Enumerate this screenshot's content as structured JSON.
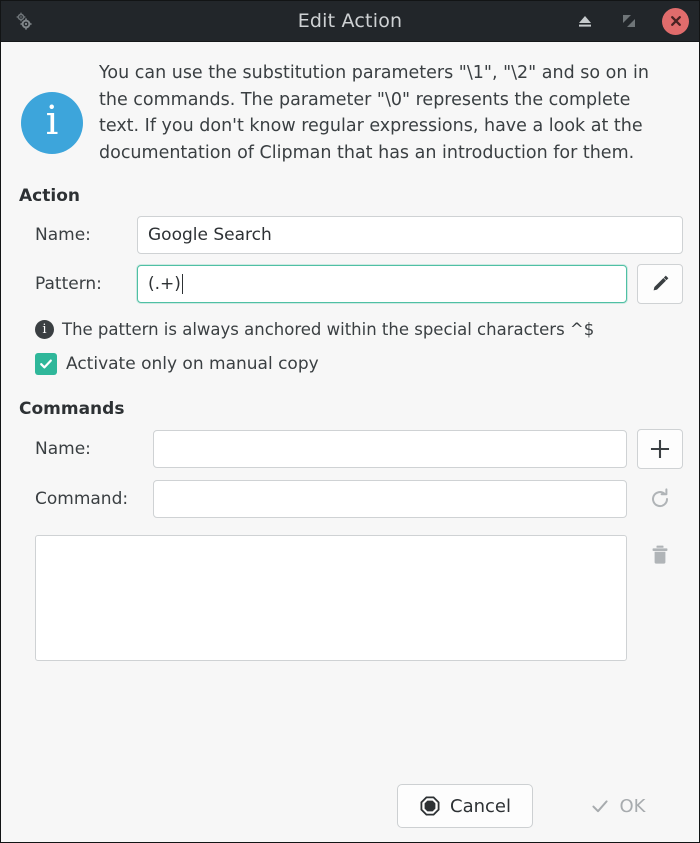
{
  "titlebar": {
    "app_icon": "cogs-icon",
    "title": "Edit Action",
    "buttons": [
      {
        "name": "shade-window-button",
        "icon": "eject-icon"
      },
      {
        "name": "maximize-window-button",
        "icon": "maximize-icon"
      },
      {
        "name": "close-window-button",
        "icon": "close-icon"
      }
    ],
    "close_color": "#e06c6c"
  },
  "info": {
    "icon": "info-circle-icon",
    "icon_color": "#3da5db",
    "glyph": "i",
    "text": "You can use the substitution parameters \"\\1\", \"\\2\" and so on in the commands. The parameter \"\\0\" represents the complete text. If you don't know regular expressions, have a look at the documentation of Clipman that has an introduction for them."
  },
  "action": {
    "section_label": "Action",
    "name_label": "Name:",
    "name_value": "Google Search",
    "name_placeholder": "",
    "pattern_label": "Pattern:",
    "pattern_value": "(.+)",
    "pattern_placeholder": "",
    "pattern_focused": true,
    "focus_color": "#4fc0a4",
    "edit_button_icon": "pencil-icon",
    "hint_icon": "info-small-icon",
    "hint_text": "The pattern is always anchored within the special characters ^$",
    "checkbox_label": "Activate only on manual copy",
    "checkbox_checked": true,
    "checkbox_color": "#2fb79a"
  },
  "commands": {
    "section_label": "Commands",
    "name_label": "Name:",
    "name_value": "",
    "name_placeholder": "",
    "add_button_icon": "plus-icon",
    "command_label": "Command:",
    "command_value": "",
    "command_placeholder": "",
    "refresh_button_icon": "refresh-icon",
    "refresh_enabled": false,
    "delete_button_icon": "trash-icon",
    "delete_enabled": false,
    "list_items": []
  },
  "footer": {
    "cancel_label": "Cancel",
    "cancel_icon": "stop-octagon-icon",
    "ok_label": "OK",
    "ok_icon": "check-icon",
    "ok_enabled": false
  }
}
